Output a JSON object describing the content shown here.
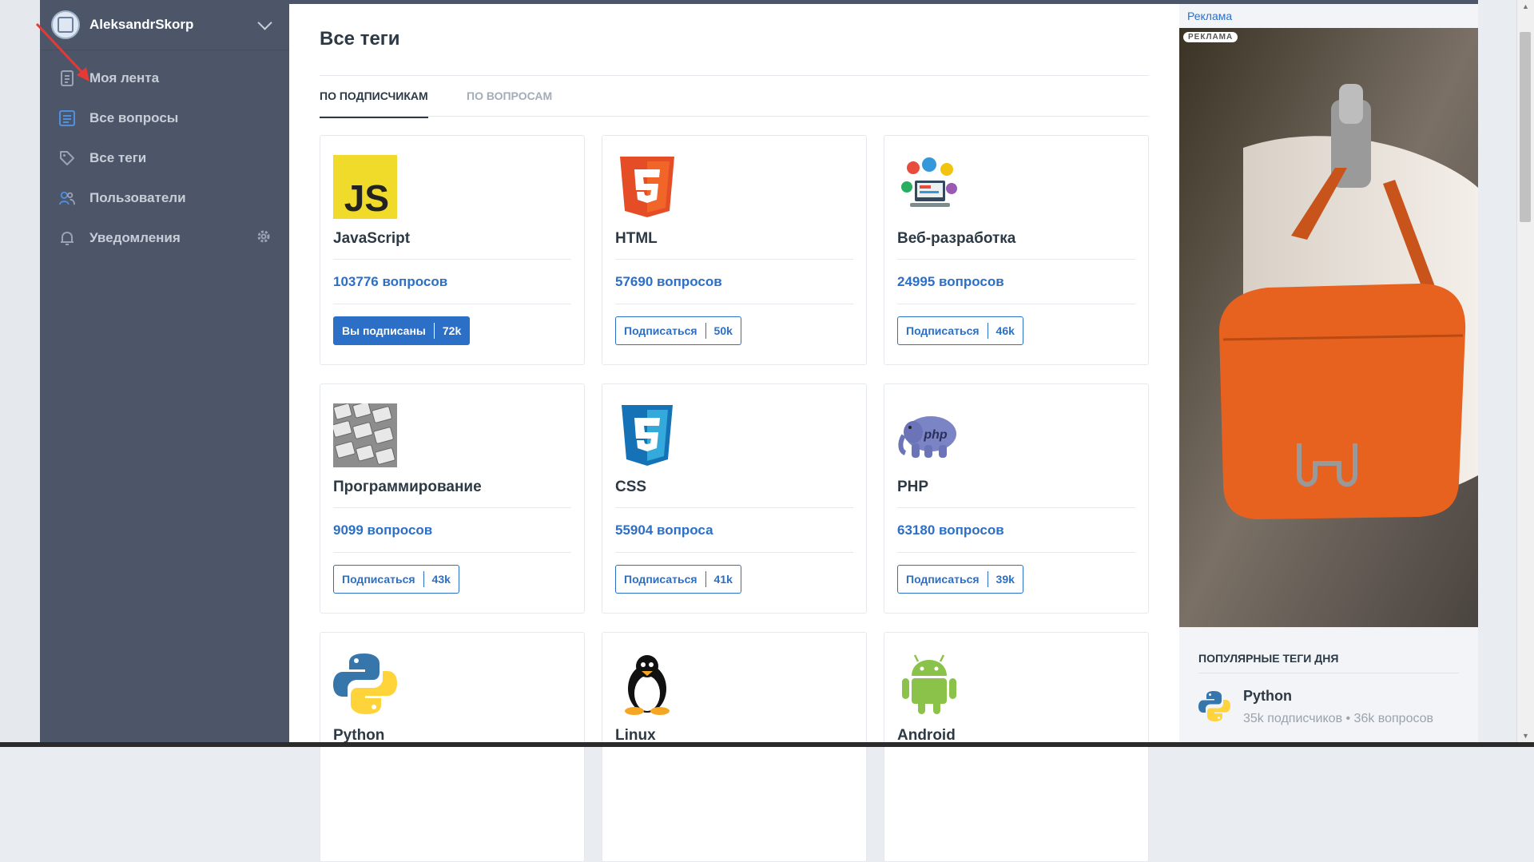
{
  "user": {
    "name": "AleksandrSkorp"
  },
  "nav": [
    {
      "label": "Моя лента",
      "icon": "feed-icon"
    },
    {
      "label": "Все вопросы",
      "icon": "questions-icon"
    },
    {
      "label": "Все теги",
      "icon": "tag-icon"
    },
    {
      "label": "Пользователи",
      "icon": "users-icon"
    },
    {
      "label": "Уведомления",
      "icon": "bell-icon"
    }
  ],
  "main": {
    "title": "Все теги",
    "tabs": [
      {
        "label": "По подписчикам",
        "active": true
      },
      {
        "label": "По вопросам",
        "active": false
      }
    ],
    "cards": [
      {
        "name": "JavaScript",
        "questions": "103776 вопросов",
        "sub_label": "Вы подписаны",
        "sub_count": "72k",
        "subscribed": true,
        "icon": "javascript-logo-icon"
      },
      {
        "name": "HTML",
        "questions": "57690 вопросов",
        "sub_label": "Подписаться",
        "sub_count": "50k",
        "subscribed": false,
        "icon": "html5-logo-icon"
      },
      {
        "name": "Веб-разработка",
        "questions": "24995 вопросов",
        "sub_label": "Подписаться",
        "sub_count": "46k",
        "subscribed": false,
        "icon": "web-dev-icon"
      },
      {
        "name": "Программирование",
        "questions": "9099 вопросов",
        "sub_label": "Подписаться",
        "sub_count": "43k",
        "subscribed": false,
        "icon": "keyboard-icon"
      },
      {
        "name": "CSS",
        "questions": "55904 вопроса",
        "sub_label": "Подписаться",
        "sub_count": "41k",
        "subscribed": false,
        "icon": "css3-logo-icon"
      },
      {
        "name": "PHP",
        "questions": "63180 вопросов",
        "sub_label": "Подписаться",
        "sub_count": "39k",
        "subscribed": false,
        "icon": "php-elephant-icon"
      },
      {
        "name": "Python",
        "icon": "python-logo-icon"
      },
      {
        "name": "Linux",
        "icon": "tux-penguin-icon"
      },
      {
        "name": "Android",
        "icon": "android-robot-icon"
      }
    ]
  },
  "sidebar_right": {
    "ad_link": "Реклама",
    "ad_badge": "РЕКЛАМА",
    "popular_title": "Популярные теги дня",
    "popular": [
      {
        "name": "Python",
        "meta": "35k подписчиков • 36k вопросов",
        "icon": "python-logo-icon"
      }
    ]
  },
  "colors": {
    "accent": "#2c6fc6",
    "sidebar": "#4d5669",
    "text": "#2d3a45"
  }
}
